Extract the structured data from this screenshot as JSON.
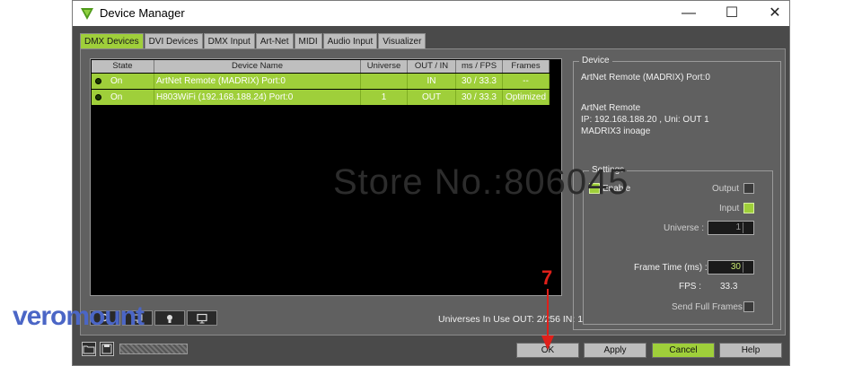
{
  "window": {
    "title": "Device Manager"
  },
  "titlebar": {
    "minimize": "—",
    "maximize": "☐",
    "close": "✕"
  },
  "tabs": [
    "DMX Devices",
    "DVI Devices",
    "DMX Input",
    "Art-Net",
    "MIDI",
    "Audio Input",
    "Visualizer"
  ],
  "table": {
    "columns": [
      "State",
      "Device Name",
      "Universe",
      "OUT / IN",
      "ms / FPS",
      "Frames"
    ],
    "rows": [
      {
        "state": "On",
        "name": "ArtNet Remote (MADRIX) Port:0",
        "universe": "",
        "io": "IN",
        "ms": "30 / 33.3",
        "frames": "--"
      },
      {
        "state": "On",
        "name": "H803WiFi (192.168.188.24) Port:0",
        "universe": "1",
        "io": "OUT",
        "ms": "30 / 33.3",
        "frames": "Optimized"
      }
    ]
  },
  "watermark": "Store No.:806045",
  "status": {
    "universes": "Universes In Use OUT: 2/256 IN: 1"
  },
  "device": {
    "legend": "Device",
    "line1": "ArtNet Remote (MADRIX) Port:0",
    "line2": "ArtNet Remote",
    "line3": "IP: 192.168.188.20 , Uni: OUT 1",
    "line4": "MADRIX3 inoage"
  },
  "settings": {
    "legend": "Settings",
    "enable": "Enable",
    "output": "Output",
    "input": "Input",
    "universe_label": "Universe :",
    "universe_value": "1",
    "frame_time_label": "Frame Time (ms) :",
    "frame_time_value": "30",
    "fps_label": "FPS :",
    "fps_value": "33.3",
    "send_full": "Send Full Frames"
  },
  "buttons": {
    "ok": "OK",
    "apply": "Apply",
    "cancel": "Cancel",
    "help": "Help"
  },
  "annotation": {
    "step": "7"
  },
  "brand": "veromount",
  "colors": {
    "accent": "#9fcf3a",
    "window_bg": "#4a4a4a",
    "panel_bg": "#606060",
    "arrow": "#e0201a",
    "brand": "#4b66c6"
  }
}
